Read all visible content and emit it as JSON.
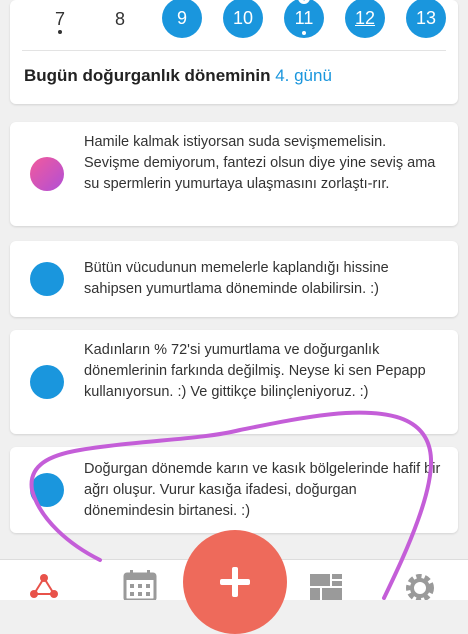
{
  "calendar": {
    "days": [
      {
        "label": "7",
        "fertile": false,
        "dot": true
      },
      {
        "label": "8",
        "fertile": false
      },
      {
        "label": "9",
        "fertile": true
      },
      {
        "label": "10",
        "fertile": true
      },
      {
        "label": "11",
        "fertile": true,
        "dot": true,
        "heart": true
      },
      {
        "label": "12",
        "fertile": true,
        "underline": true
      },
      {
        "label": "13",
        "fertile": true
      }
    ]
  },
  "fertility_status": {
    "prefix": "Bugün doğurganlık döneminin ",
    "highlight": "4. günü"
  },
  "tips": [
    {
      "text": "Hamile kalmak istiyorsan suda sevişmemelisin. Sevişme demiyorum, fantezi olsun diye yine seviş ama su spermlerin yumurtaya ulaşmasını zorlaştı-rır.",
      "icon": "gradient-circle-icon"
    },
    {
      "text": "Bütün vücudunun memelerle kaplandığı hissine sahipsen yumurtlama döneminde olabilirsin. :)",
      "icon": "blue-circle-icon"
    },
    {
      "text": "Kadınların % 72'si yumurtlama ve doğurganlık dönemlerinin farkında değilmiş. Neyse ki sen Pepapp kullanıyorsun. :) Ve gittikçe bilinçleniyoruz. :)",
      "icon": "blue-circle-icon"
    },
    {
      "text": "Doğurgan dönemde karın ve kasık bölgelerinde hafif bir ağrı oluşur. Vurur kasığa ifadesi, doğurgan dönemindesin birtanesi. :)",
      "icon": "blue-circle-icon"
    }
  ],
  "colors": {
    "accent": "#1a96dd",
    "fab": "#ee6a5b",
    "scribble": "#c45ed8",
    "nav_icon": "#9a9a9a",
    "nav_active": "#e8524a"
  },
  "bottom_nav": {
    "items": [
      "molecule-icon",
      "calendar-icon",
      "add-icon",
      "blocks-icon",
      "gear-icon"
    ]
  }
}
